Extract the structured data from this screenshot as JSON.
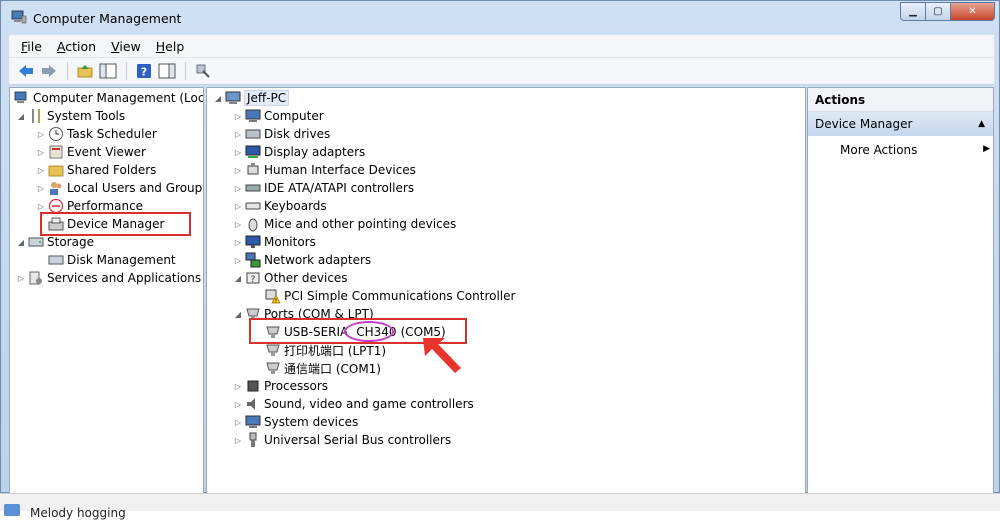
{
  "window": {
    "title": "Computer Management"
  },
  "menu": {
    "items": [
      "File",
      "Action",
      "View",
      "Help"
    ]
  },
  "toolbar": {
    "icons": [
      "back-arrow-icon",
      "forward-arrow-icon",
      "up-folder-icon",
      "show-hide-tree-icon",
      "help-icon",
      "console-tree-icon",
      "properties-icon"
    ]
  },
  "left_tree": {
    "root": "Computer Management (Local",
    "system_tools": "System Tools",
    "task_scheduler": "Task Scheduler",
    "event_viewer": "Event Viewer",
    "shared_folders": "Shared Folders",
    "local_users": "Local Users and Groups",
    "performance": "Performance",
    "device_manager": "Device Manager",
    "storage": "Storage",
    "disk_management": "Disk Management",
    "services": "Services and Applications"
  },
  "devices": {
    "root": "Jeff-PC",
    "computer": "Computer",
    "disk_drives": "Disk drives",
    "display_adapters": "Display adapters",
    "hid": "Human Interface Devices",
    "ide": "IDE ATA/ATAPI controllers",
    "keyboards": "Keyboards",
    "mice": "Mice and other pointing devices",
    "monitors": "Monitors",
    "network": "Network adapters",
    "other": "Other devices",
    "pci_comm": "PCI Simple Communications Controller",
    "ports": "Ports (COM & LPT)",
    "usb_serial_prefix": "USB-SERIA",
    "usb_serial_chip": "CH340",
    "usb_serial_port": "(COM5)",
    "lpt1": "打印机端口 (LPT1)",
    "com1": "通信端口 (COM1)",
    "processors": "Processors",
    "sound": "Sound, video and game controllers",
    "system_devices": "System devices",
    "usb": "Universal Serial Bus controllers"
  },
  "actions": {
    "header": "Actions",
    "section": "Device Manager",
    "more": "More Actions"
  },
  "status": {
    "text": "Melody hogging"
  },
  "colors": {
    "highlight_box": "#d9302c",
    "oval": "#c53acd",
    "pointer_arrow": "#e8342a"
  }
}
